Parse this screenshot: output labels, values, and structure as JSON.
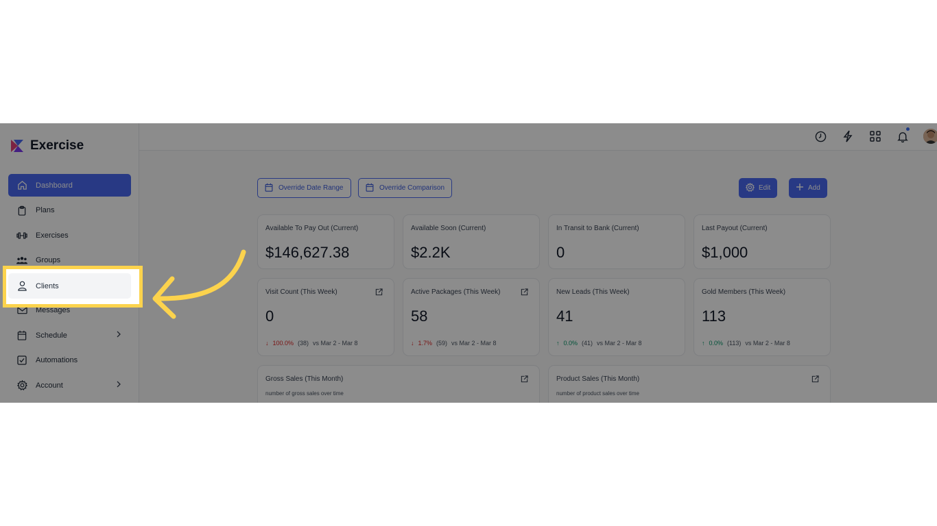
{
  "app": {
    "name": "Exercise"
  },
  "sidebar": {
    "items": [
      {
        "label": "Dashboard",
        "icon": "home-icon",
        "active": true
      },
      {
        "label": "Plans",
        "icon": "clipboard-icon"
      },
      {
        "label": "Exercises",
        "icon": "dumbbell-icon"
      },
      {
        "label": "Groups",
        "icon": "groups-icon"
      },
      {
        "label": "Clients",
        "icon": "user-icon"
      },
      {
        "label": "Messages",
        "icon": "mail-icon"
      },
      {
        "label": "Schedule",
        "icon": "calendar-icon",
        "has_submenu": true
      },
      {
        "label": "Automations",
        "icon": "check-square-icon"
      },
      {
        "label": "Account",
        "icon": "gear-icon",
        "has_submenu": true
      }
    ]
  },
  "topbar": {
    "icons": [
      "clock-icon",
      "lightning-icon",
      "grid-icon",
      "bell-icon",
      "avatar"
    ]
  },
  "toolbar": {
    "override_date_range": "Override Date Range",
    "override_comparison": "Override Comparison",
    "edit": "Edit",
    "add": "Add"
  },
  "stats_row1": [
    {
      "label": "Available To Pay Out (Current)",
      "value": "$146,627.38"
    },
    {
      "label": "Available Soon (Current)",
      "value": "$2.2K"
    },
    {
      "label": "In Transit to Bank (Current)",
      "value": "0"
    },
    {
      "label": "Last Payout (Current)",
      "value": "$1,000"
    }
  ],
  "stats_row2": [
    {
      "label": "Visit Count (This Week)",
      "value": "0",
      "change": "100.0%",
      "direction": "down",
      "prev": "(38)",
      "period": "vs Mar 2 - Mar 8"
    },
    {
      "label": "Active Packages (This Week)",
      "value": "58",
      "change": "1.7%",
      "direction": "down",
      "prev": "(59)",
      "period": "vs Mar 2 - Mar 8"
    },
    {
      "label": "New Leads (This Week)",
      "value": "41",
      "change": "0.0%",
      "direction": "up",
      "prev": "(41)",
      "period": "vs Mar 2 - Mar 8"
    },
    {
      "label": "Gold Members (This Week)",
      "value": "113",
      "change": "0.0%",
      "direction": "up",
      "prev": "(113)",
      "period": "vs Mar 2 - Mar 8"
    }
  ],
  "charts": [
    {
      "title": "Gross Sales (This Month)",
      "subtitle": "number of gross sales over time"
    },
    {
      "title": "Product Sales (This Month)",
      "subtitle": "number of product sales over time"
    }
  ],
  "colors": {
    "primary": "#4a68f0",
    "highlight": "#fcd34d",
    "negative": "#dc2626",
    "positive": "#059669"
  }
}
